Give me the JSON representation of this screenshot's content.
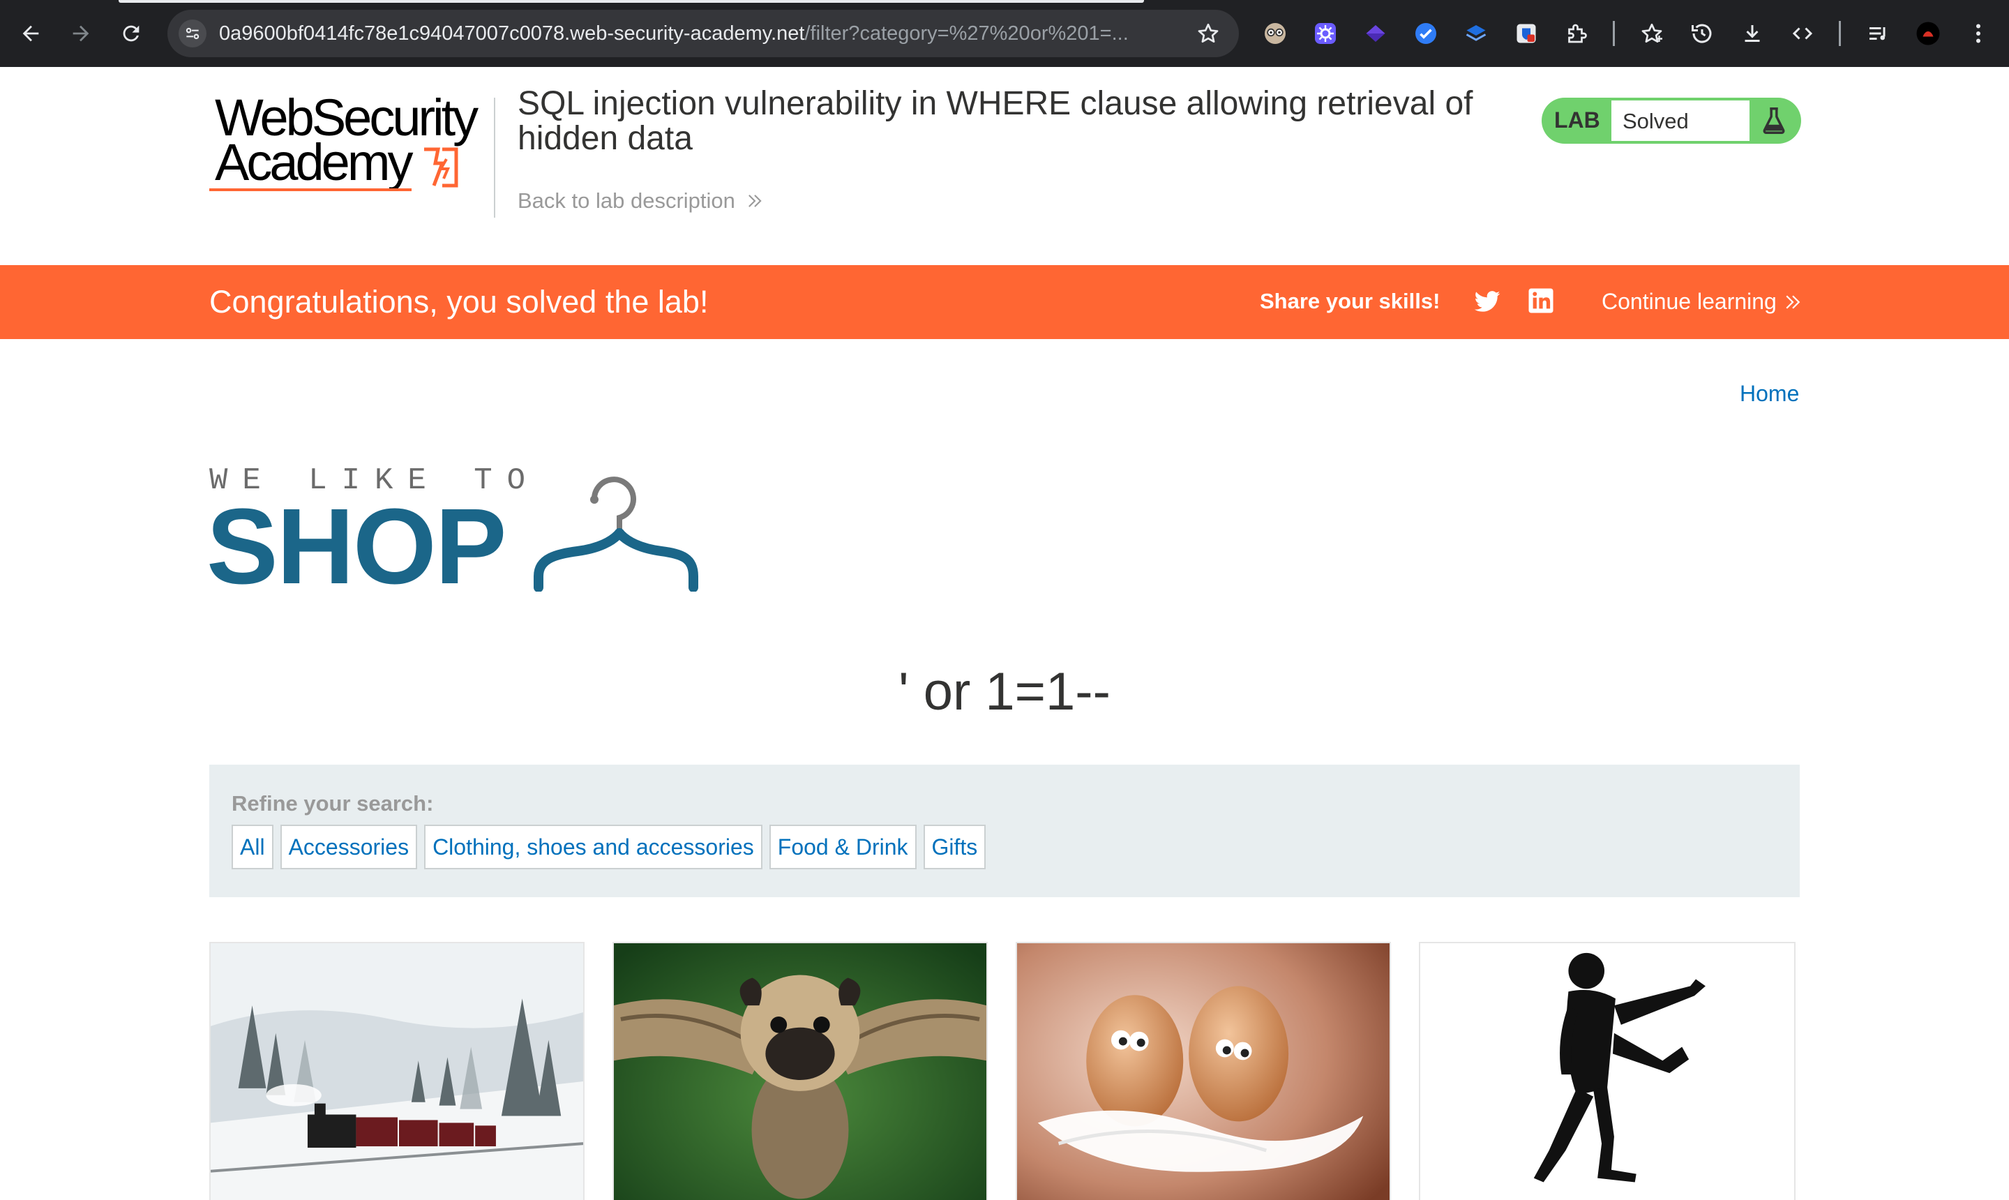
{
  "browser": {
    "url_host": "0a9600bf0414fc78e1c94047007c0078.web-security-academy.net",
    "url_rest": "/filter?category=%27%20or%201=..."
  },
  "lab": {
    "logo_line1": "WebSecurity",
    "logo_line2": "Academy",
    "title": "SQL injection vulnerability in WHERE clause allowing retrieval of hidden data",
    "back_link": "Back to lab description",
    "badge": "LAB",
    "status": "Solved",
    "accent_color": "#ff6633",
    "solved_color": "#70d16d"
  },
  "banner": {
    "message": "Congratulations, you solved the lab!",
    "share_label": "Share your skills!",
    "continue_label": "Continue learning"
  },
  "shop": {
    "home_link": "Home",
    "tagline": "WE LIKE TO",
    "brand": "SHOP",
    "search_term": "' or 1=1--",
    "refine_label": "Refine your search:",
    "filters": [
      "All",
      "Accessories",
      "Clothing, shoes and accessories",
      "Food & Drink",
      "Gifts"
    ],
    "brand_color": "#1b6689",
    "link_color": "#0071bc"
  }
}
